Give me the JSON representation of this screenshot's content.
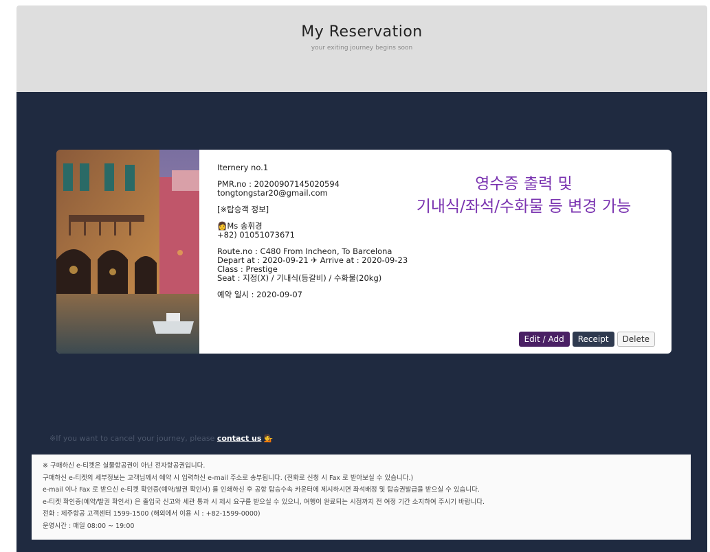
{
  "header": {
    "title": "My Reservation",
    "subtitle": "your exiting journey begins soon"
  },
  "reservation": {
    "itinerary": "Iternery no.1",
    "pmr": "PMR.no : 20200907145020594",
    "email": "tongtongstar20@gmail.com",
    "passenger_header": "[※탑승객 정보]",
    "passenger_name": "Ms 송휘경",
    "passenger_phone": "+82) 01051073671",
    "route": "Route.no : C480  From Incheon, To Barcelona",
    "depart_prefix": "Depart at : 2020-09-21",
    "plane_glyph": "✈",
    "arrive": "Arrive at : 2020-09-23",
    "class": "Class : Prestige",
    "seat": "Seat : 지정(X) / 기내식(등갈비) / 수화물(20kg)",
    "booking_date": "예약 일시 : 2020-09-07"
  },
  "promo": {
    "line1": "영수증 출력 및",
    "line2": "기내식/좌석/수화물 등 변경 가능"
  },
  "buttons": {
    "edit": "Edit / Add",
    "receipt": "Receipt",
    "delete": "Delete"
  },
  "cancel": {
    "text": "※If you want to cancel your journey, please",
    "link": "contact us"
  },
  "notice": {
    "lines": [
      "※ 구매하신 e-티켓은 실물항공권이 아닌 전자항공권입니다.",
      "구매하신 e-티켓의 세부정보는 고객님께서 예약 시 입력하신 e-mail 주소로 송부됩니다. (전화로 신청 시 Fax 로 받아보실 수 있습니다.)",
      "e-mail 이나 Fax 로 받으신 e-티켓 확인증(예약/발권 확인서) 를 인쇄하신 후 공항 탑승수속 카운터에 제시하시면 좌석배정 및 탑승권발급을 받으실 수 있습니다.",
      "e-티켓 확인증(예약/발권 확인서) 은 출입국 신고와 세관 통과 시 제시 요구를 받으실 수 있으니, 여행이 완료되는 시점까지 전 여정 기간 소지하여 주시기 바랍니다.",
      "전화 : 제주항공 고객센터 1599-1500 (해외에서 이용 시 : +82-1599-0000)",
      "운영시간 : 매일 08:00 ~ 19:00"
    ]
  },
  "colors": {
    "header_bg": "#dedede",
    "main_bg": "#1f2a40",
    "promo": "#7a33b0",
    "edit_button": "#4a2064",
    "receipt_button": "#2f3a4f"
  }
}
